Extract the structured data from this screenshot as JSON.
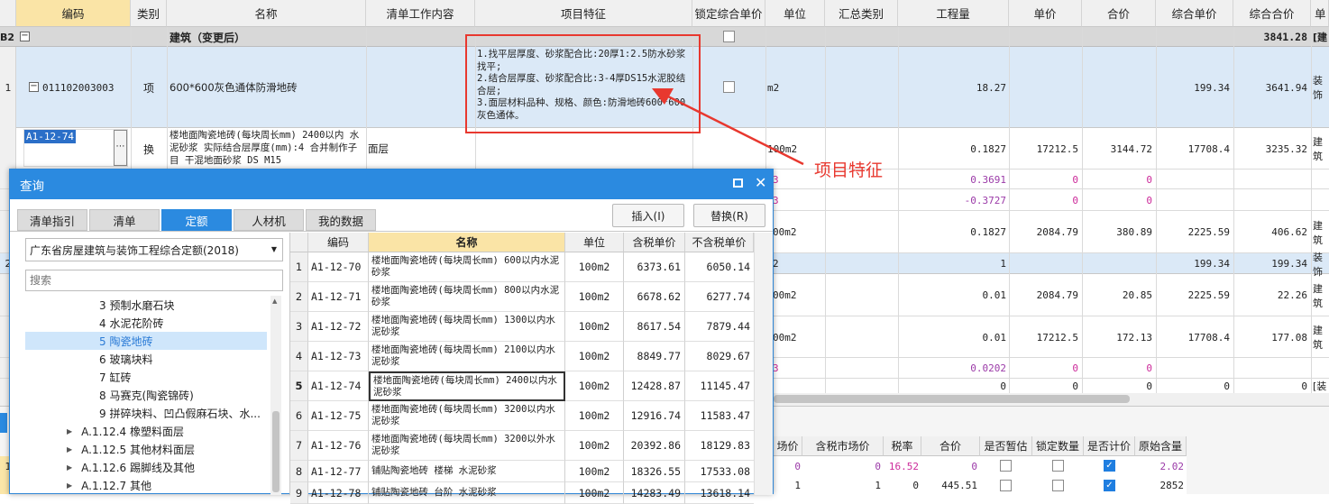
{
  "main_table": {
    "headers": [
      "编码",
      "类别",
      "名称",
      "清单工作内容",
      "项目特征",
      "锁定综合单价",
      "单位",
      "汇总类别",
      "工程量",
      "单价",
      "合价",
      "综合单价",
      "综合合价",
      "单"
    ],
    "group_row": {
      "index": "B2",
      "name": "建筑（变更后）",
      "total": "3841.28",
      "tail": "[建"
    },
    "row1": {
      "index": "1",
      "code": "011102003003",
      "type": "项",
      "name": "600*600灰色通体防滑地砖",
      "features": [
        "1.找平层厚度、砂浆配合比:20厚1:2.5防水砂浆找平;",
        "2.结合层厚度、砂浆配合比:3-4厚DS15水泥胶结合层;",
        "3.面层材料品种、规格、颜色:防滑地砖600*600灰色通体。"
      ],
      "unit": "m2",
      "qty": "18.27",
      "unit_price": "199.34",
      "total": "3641.94",
      "tail": "装饰"
    },
    "row2": {
      "code": "A1-12-74",
      "type": "换",
      "name": "楼地面陶瓷地砖(每块周长mm) 2400以内 水泥砂浆  实际结合层厚度(mm):4  合并制作子目 干混地面砂浆 DS M15",
      "work": "面层",
      "unit": "100m2",
      "qty": "0.1827",
      "price": "17212.5",
      "amount": "3144.72",
      "comp_price": "17708.4",
      "comp_amount": "3235.32",
      "tail": "建筑"
    },
    "row3": {
      "qty": "0.3691",
      "price": "0",
      "amount": "0",
      "unit_frag": "3"
    },
    "row4": {
      "qty": "-0.3727",
      "price": "0",
      "amount": "0",
      "unit_frag": "3"
    },
    "row5": {
      "unit": "00m2",
      "qty": "0.1827",
      "price": "2084.79",
      "amount": "380.89",
      "comp_price": "2225.59",
      "comp_amount": "406.62",
      "tail": "建筑"
    },
    "row6": {
      "index": "2",
      "unit_frag": "2",
      "qty": "1",
      "comp_price": "199.34",
      "comp_amount": "199.34",
      "tail": "装饰"
    },
    "row7": {
      "unit": "00m2",
      "qty": "0.01",
      "price": "2084.79",
      "amount": "20.85",
      "comp_price": "2225.59",
      "comp_amount": "22.26",
      "tail": "建筑"
    },
    "row8": {
      "unit": "00m2",
      "qty": "0.01",
      "price": "17212.5",
      "amount": "172.13",
      "comp_price": "17708.4",
      "comp_amount": "177.08",
      "tail": "建筑"
    },
    "row9": {
      "unit_frag": "3",
      "qty": "0.0202",
      "price": "0",
      "amount": "0"
    },
    "row10": {
      "qty": "0",
      "price": "0",
      "amount": "0",
      "comp_price": "0",
      "comp_amount": "0",
      "tail": "[装"
    }
  },
  "annotation": {
    "label": "项目特征",
    "color": "#e8382f"
  },
  "bottom_table": {
    "headers": [
      "场价",
      "含税市场价",
      "税率",
      "合价",
      "是否暂估",
      "锁定数量",
      "是否计价",
      "原始含量"
    ],
    "row1": {
      "row_no": "1",
      "market": "0",
      "taxed_market": "0",
      "rate": "16.52",
      "amount": "0",
      "original": "2.02"
    },
    "row2": {
      "market": "1",
      "taxed_market": "1",
      "rate": "0",
      "amount": "445.51",
      "original": "2852"
    }
  },
  "dialog": {
    "title": "查询",
    "tabs": [
      "清单指引",
      "清单",
      "定额",
      "人材机",
      "我的数据"
    ],
    "selected_tab": "定额",
    "insert_button": "插入(I)",
    "replace_button": "替换(R)",
    "library_select": "广东省房屋建筑与装饰工程综合定额(2018)",
    "search_placeholder": "搜索",
    "tree": [
      {
        "label": "3 预制水磨石块",
        "level": 2
      },
      {
        "label": "4 水泥花阶砖",
        "level": 2
      },
      {
        "label": "5 陶瓷地砖",
        "level": 2,
        "selected": true
      },
      {
        "label": "6 玻璃块料",
        "level": 2
      },
      {
        "label": "7 缸砖",
        "level": 2
      },
      {
        "label": "8 马赛克(陶瓷锦砖)",
        "level": 2
      },
      {
        "label": "9 拼碎块料、凹凸假麻石块、水...",
        "level": 2
      },
      {
        "label": "A.1.12.4 橡塑料面层",
        "level": 1
      },
      {
        "label": "A.1.12.5 其他材料面层",
        "level": 1
      },
      {
        "label": "A.1.12.6 踢脚线及其他",
        "level": 1
      },
      {
        "label": "A.1.12.7 其他",
        "level": 1
      }
    ],
    "results": {
      "headers": [
        "编码",
        "名称",
        "单位",
        "含税单价",
        "不含税单价"
      ],
      "rows": [
        {
          "no": "1",
          "code": "A1-12-70",
          "name": "楼地面陶瓷地砖(每块周长mm) 600以内水泥砂浆",
          "unit": "100m2",
          "taxed": "6373.61",
          "untaxed": "6050.14"
        },
        {
          "no": "2",
          "code": "A1-12-71",
          "name": "楼地面陶瓷地砖(每块周长mm) 800以内水泥砂浆",
          "unit": "100m2",
          "taxed": "6678.62",
          "untaxed": "6277.74"
        },
        {
          "no": "3",
          "code": "A1-12-72",
          "name": "楼地面陶瓷地砖(每块周长mm) 1300以内水泥砂浆",
          "unit": "100m2",
          "taxed": "8617.54",
          "untaxed": "7879.44"
        },
        {
          "no": "4",
          "code": "A1-12-73",
          "name": "楼地面陶瓷地砖(每块周长mm) 2100以内水泥砂浆",
          "unit": "100m2",
          "taxed": "8849.77",
          "untaxed": "8029.67"
        },
        {
          "no": "5",
          "code": "A1-12-74",
          "name": "楼地面陶瓷地砖(每块周长mm) 2400以内水泥砂浆",
          "unit": "100m2",
          "taxed": "12428.87",
          "untaxed": "11145.47",
          "selected": true
        },
        {
          "no": "6",
          "code": "A1-12-75",
          "name": "楼地面陶瓷地砖(每块周长mm) 3200以内水泥砂浆",
          "unit": "100m2",
          "taxed": "12916.74",
          "untaxed": "11583.47"
        },
        {
          "no": "7",
          "code": "A1-12-76",
          "name": "楼地面陶瓷地砖(每块周长mm) 3200以外水泥砂浆",
          "unit": "100m2",
          "taxed": "20392.86",
          "untaxed": "18129.83"
        },
        {
          "no": "8",
          "code": "A1-12-77",
          "name": "铺贴陶瓷地砖 楼梯 水泥砂浆",
          "unit": "100m2",
          "taxed": "18326.55",
          "untaxed": "17533.08"
        },
        {
          "no": "9",
          "code": "A1-12-78",
          "name": "铺贴陶瓷地砖 台阶 水泥砂浆",
          "unit": "100m2",
          "taxed": "14283.49",
          "untaxed": "13618.14"
        }
      ]
    }
  }
}
